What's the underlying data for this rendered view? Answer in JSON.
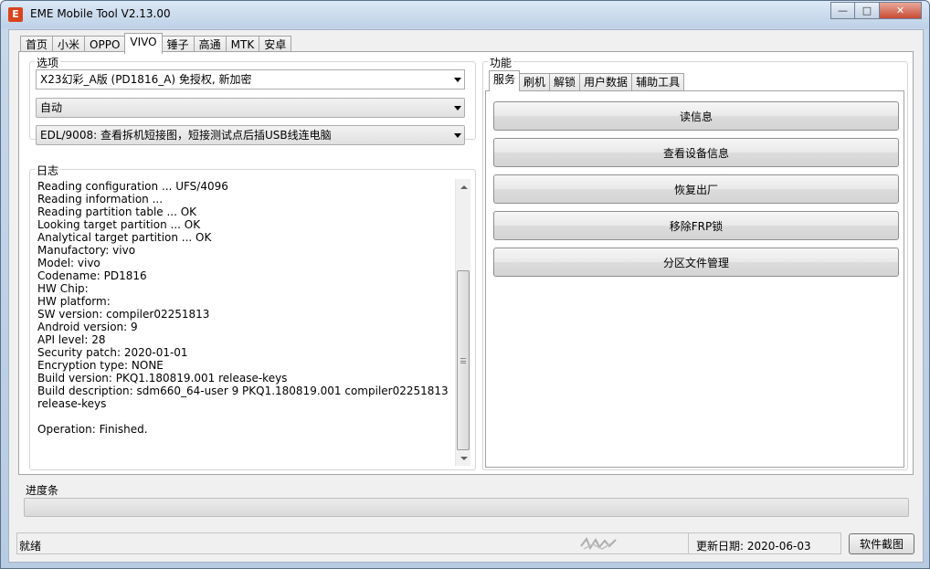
{
  "window": {
    "title": "EME Mobile Tool V2.13.00",
    "app_icon_glyph": "E",
    "controls": {
      "minimize": "—",
      "maximize": "□",
      "close": "✕"
    }
  },
  "tabs": [
    "首页",
    "小米",
    "OPPO",
    "VIVO",
    "锤子",
    "高通",
    "MTK",
    "安卓"
  ],
  "active_tab": "VIVO",
  "options": {
    "label": "选项",
    "model_select": "X23幻彩_A版 (PD1816_A) 免授权, 新加密",
    "mode_select": "自动",
    "edl_select": "EDL/9008: 查看拆机短接图，短接测试点后插USB线连电脑"
  },
  "log": {
    "label": "日志",
    "lines": [
      "Reading configuration ... UFS/4096",
      "Reading information ...",
      "Reading partition table ... OK",
      "Looking target partition ... OK",
      "Analytical target partition ... OK",
      "Manufactory: vivo",
      "Model: vivo",
      "Codename: PD1816",
      "HW Chip:",
      "HW platform:",
      "SW version: compiler02251813",
      "Android version: 9",
      "API level: 28",
      "Security patch: 2020-01-01",
      "Encryption type: NONE",
      "Build version: PKQ1.180819.001 release-keys",
      "Build description: sdm660_64-user 9 PKQ1.180819.001 compiler02251813",
      "release-keys",
      "",
      "Operation: Finished."
    ]
  },
  "functions": {
    "label": "功能",
    "tabs": [
      "服务",
      "刷机",
      "解锁",
      "用户数据",
      "辅助工具"
    ],
    "active_tab": "服务",
    "buttons": [
      "读信息",
      "查看设备信息",
      "恢复出厂",
      "移除FRP锁",
      "分区文件管理"
    ]
  },
  "progress": {
    "label": "进度条",
    "value": 0
  },
  "status": {
    "left": "就绪",
    "update_date": "更新日期:  2020-06-03",
    "snapshot_button": "软件截图"
  },
  "colors": {
    "progress_fill": "#06b025",
    "close_button": "#c84b33",
    "app_icon": "#d9441c"
  }
}
